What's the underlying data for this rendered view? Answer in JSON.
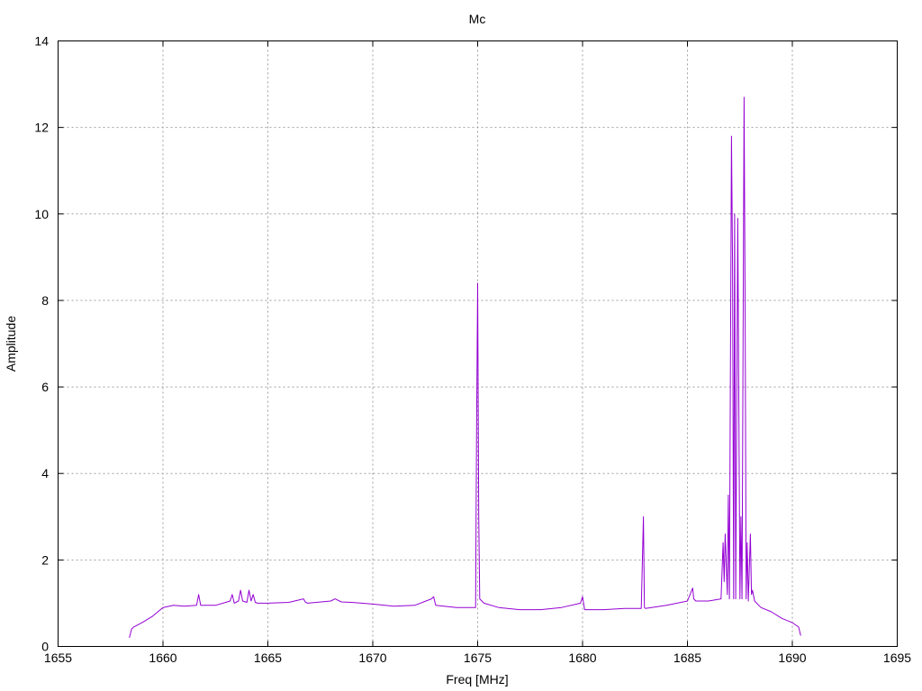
{
  "chart_data": {
    "type": "line",
    "title": "Mc",
    "xlabel": "Freq [MHz]",
    "ylabel": "Amplitude",
    "xlim": [
      1655,
      1695
    ],
    "ylim": [
      0,
      14
    ],
    "xticks": [
      "1655",
      "1660",
      "1665",
      "1670",
      "1675",
      "1680",
      "1685",
      "1690",
      "1695"
    ],
    "yticks": [
      "0",
      "2",
      "4",
      "6",
      "8",
      "10",
      "12",
      "14"
    ],
    "grid": true,
    "series_color": "#9400d3",
    "series": [
      {
        "x": [
          1658.4,
          1658.5,
          1658.6,
          1659.0,
          1659.5,
          1660.0,
          1660.5,
          1661.0,
          1661.6,
          1661.7,
          1661.8,
          1662.5,
          1663.2,
          1663.3,
          1663.4,
          1663.6,
          1663.7,
          1663.8,
          1664.0,
          1664.1,
          1664.2,
          1664.3,
          1664.4,
          1664.5,
          1665.0,
          1666.0,
          1666.7,
          1666.8,
          1666.9,
          1668.0,
          1668.2,
          1668.5,
          1669.0,
          1670.0,
          1671.0,
          1672.0,
          1672.8,
          1672.9,
          1673.0,
          1674.0,
          1674.9,
          1674.95,
          1675.0,
          1675.05,
          1675.1,
          1675.3,
          1676.0,
          1677.0,
          1678.0,
          1679.0,
          1679.9,
          1680.0,
          1680.1,
          1681.0,
          1682.0,
          1682.8,
          1682.9,
          1682.95,
          1683.0,
          1684.0,
          1685.0,
          1685.25,
          1685.3,
          1685.4,
          1686.0,
          1686.6,
          1686.7,
          1686.75,
          1686.8,
          1686.9,
          1686.95,
          1687.0,
          1687.1,
          1687.15,
          1687.2,
          1687.25,
          1687.3,
          1687.4,
          1687.45,
          1687.5,
          1687.55,
          1687.6,
          1687.7,
          1687.75,
          1687.8,
          1687.85,
          1687.9,
          1688.0,
          1688.05,
          1688.1,
          1688.2,
          1688.5,
          1689.0,
          1689.5,
          1690.0,
          1690.3,
          1690.4
        ],
        "y": [
          0.2,
          0.4,
          0.45,
          0.55,
          0.7,
          0.9,
          0.95,
          0.93,
          0.95,
          1.2,
          0.95,
          0.95,
          1.05,
          1.2,
          1.0,
          1.05,
          1.3,
          1.05,
          1.02,
          1.3,
          1.05,
          1.2,
          1.02,
          1.0,
          1.0,
          1.02,
          1.1,
          1.02,
          1.0,
          1.05,
          1.1,
          1.03,
          1.02,
          0.98,
          0.93,
          0.95,
          1.1,
          1.15,
          0.95,
          0.9,
          0.9,
          5.0,
          8.4,
          3.0,
          1.1,
          1.0,
          0.9,
          0.85,
          0.85,
          0.9,
          1.0,
          1.15,
          0.85,
          0.85,
          0.88,
          0.88,
          3.0,
          0.9,
          0.88,
          0.95,
          1.05,
          1.35,
          1.1,
          1.05,
          1.05,
          1.1,
          2.4,
          1.5,
          2.6,
          1.2,
          3.5,
          1.1,
          11.8,
          8.8,
          1.1,
          10.0,
          1.1,
          9.9,
          5.5,
          1.1,
          3.0,
          1.1,
          12.7,
          7.6,
          1.1,
          2.4,
          1.05,
          2.6,
          1.2,
          1.3,
          1.05,
          0.9,
          0.8,
          0.65,
          0.55,
          0.45,
          0.25
        ]
      }
    ]
  }
}
